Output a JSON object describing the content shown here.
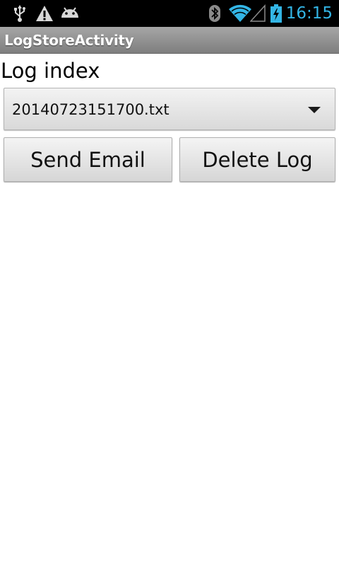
{
  "status_bar": {
    "time": "16:15",
    "icons": [
      "usb-icon",
      "warning-icon",
      "android-debug-icon",
      "bluetooth-icon",
      "wifi-icon",
      "signal-icon",
      "battery-charging-icon"
    ],
    "time_color": "#33b5e5"
  },
  "app": {
    "title": "LogStoreActivity"
  },
  "main": {
    "label": "Log index",
    "spinner": {
      "selected": "20140723151700.txt"
    },
    "buttons": {
      "send_email": "Send Email",
      "delete_log": "Delete Log"
    }
  }
}
